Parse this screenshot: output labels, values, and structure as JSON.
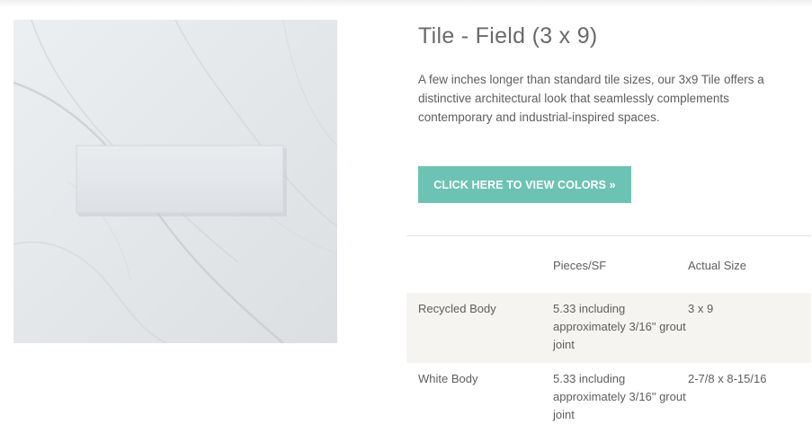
{
  "product": {
    "title": "Tile - Field (3 x 9)",
    "description": "A few inches longer than standard tile sizes, our 3x9 Tile offers a distinctive architectural look that seamlessly complements contemporary and industrial-inspired spaces.",
    "cta_label": "CLICK HERE TO VIEW COLORS »"
  },
  "spec_table": {
    "headers": [
      "",
      "Pieces/SF",
      "Actual Size"
    ],
    "rows": [
      [
        "Recycled Body",
        "5.33 including approximately 3/16\" grout joint",
        "3 x 9"
      ],
      [
        "White Body",
        "5.33 including approximately 3/16\" grout joint",
        "2-7/8 x 8-15/16"
      ]
    ]
  },
  "colors": {
    "accent": "#6cc3b4",
    "row_alt_bg": "#f6f4f1",
    "text": "#5e5e5e"
  }
}
